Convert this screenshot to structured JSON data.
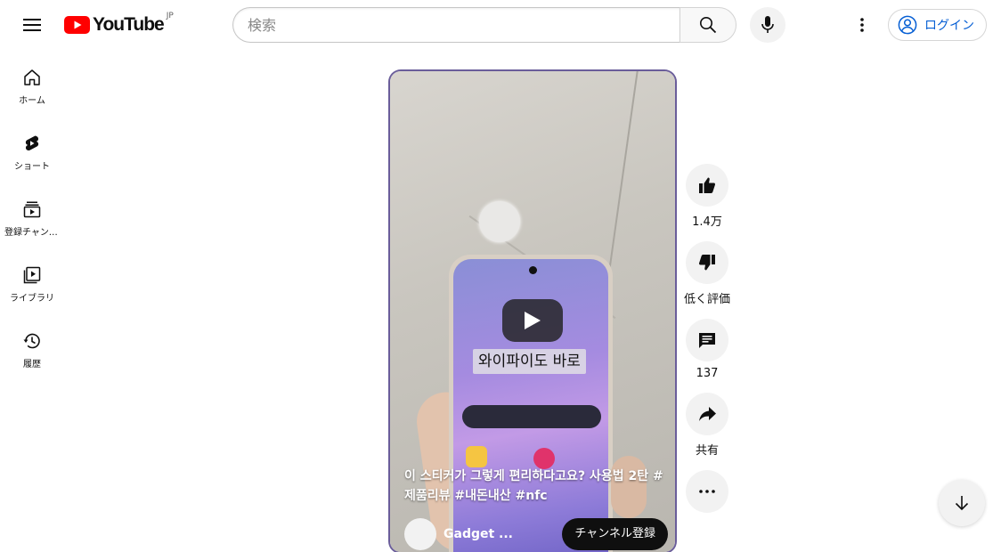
{
  "header": {
    "logo_text": "YouTube",
    "region": "JP",
    "search_placeholder": "検索",
    "signin_label": "ログイン"
  },
  "guide": {
    "items": [
      {
        "label": "ホーム",
        "icon": "home-icon"
      },
      {
        "label": "ショート",
        "icon": "shorts-icon"
      },
      {
        "label": "登録チャンネル",
        "icon": "subscriptions-icon"
      },
      {
        "label": "ライブラリ",
        "icon": "library-icon"
      },
      {
        "label": "履歴",
        "icon": "history-icon"
      }
    ]
  },
  "short": {
    "caption": "와이파이도 바로",
    "title": "이 스티커가 그렇게 편리하다고요? 사용법 2탄 #제품리뷰 #내돈내산 #nfc",
    "channel_name": "Gadget ...",
    "subscribe_label": "チャンネル登録"
  },
  "actions": {
    "like_count": "1.4万",
    "dislike_label": "低く評価",
    "comment_count": "137",
    "share_label": "共有"
  },
  "colors": {
    "brand_red": "#ff0000",
    "link_blue": "#065fd4",
    "button_gray": "#f2f2f2"
  }
}
